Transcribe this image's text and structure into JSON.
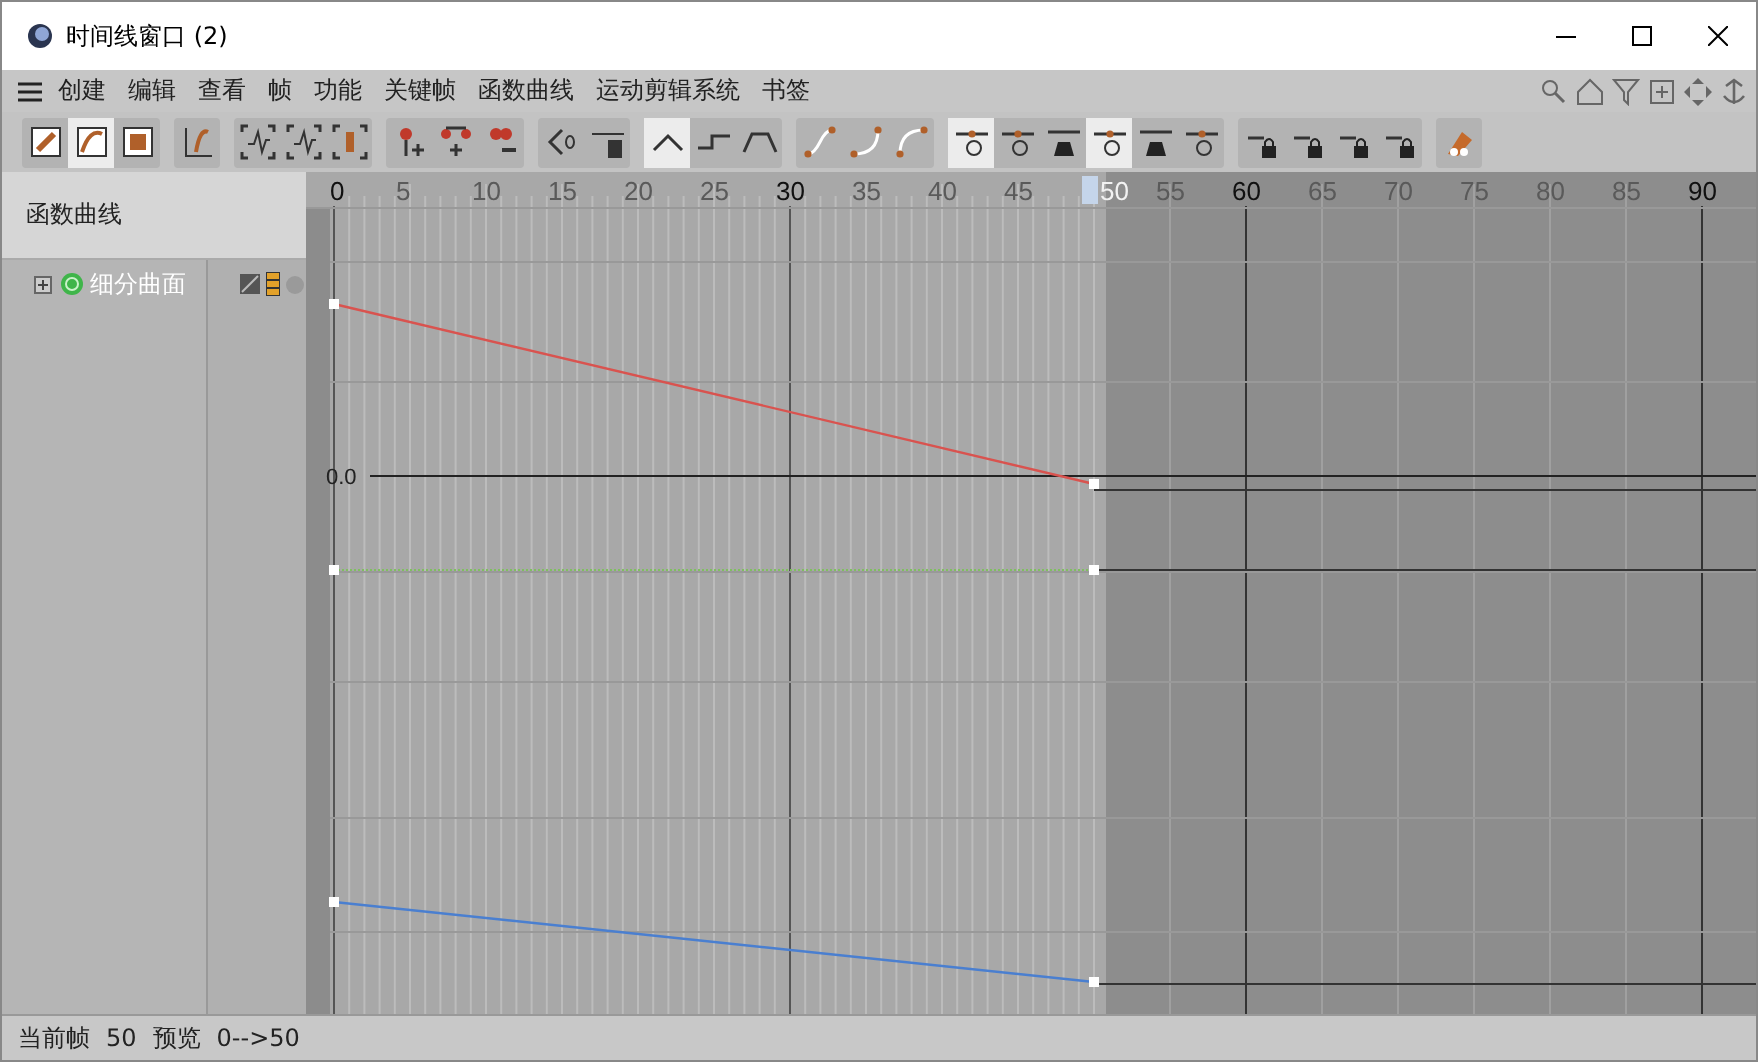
{
  "window": {
    "title": "时间线窗口 (2)"
  },
  "menu": [
    "创建",
    "编辑",
    "查看",
    "帧",
    "功能",
    "关键帧",
    "函数曲线",
    "运动剪辑系统",
    "书签"
  ],
  "toolbar": [
    [
      {
        "selected": false
      },
      {
        "selected": true
      },
      {
        "selected": false
      }
    ],
    [
      {
        "selected": false
      }
    ],
    [
      {
        "selected": false
      },
      {
        "selected": false
      },
      {
        "selected": false
      }
    ],
    [
      {
        "selected": false
      },
      {
        "selected": false
      },
      {
        "selected": false
      }
    ],
    [
      {
        "selected": false
      },
      {
        "selected": false
      }
    ],
    [
      {
        "selected": true
      },
      {
        "selected": false
      },
      {
        "selected": false
      }
    ],
    [
      {
        "selected": false
      },
      {
        "selected": false
      },
      {
        "selected": false
      }
    ],
    [
      {
        "selected": true
      },
      {
        "selected": false
      },
      {
        "selected": false
      },
      {
        "selected": true
      },
      {
        "selected": false
      },
      {
        "selected": false
      }
    ],
    [
      {
        "selected": false
      },
      {
        "selected": false
      },
      {
        "selected": false
      },
      {
        "selected": false
      }
    ],
    [
      {
        "selected": false
      }
    ]
  ],
  "panel": {
    "title": "函数曲线",
    "items": [
      {
        "label": "细分曲面",
        "expanded": false
      }
    ]
  },
  "ruler": [
    {
      "label": "0",
      "kind": "major"
    },
    {
      "label": "5",
      "kind": "minor"
    },
    {
      "label": "10",
      "kind": "minor"
    },
    {
      "label": "15",
      "kind": "minor"
    },
    {
      "label": "20",
      "kind": "minor"
    },
    {
      "label": "25",
      "kind": "minor"
    },
    {
      "label": "30",
      "kind": "major"
    },
    {
      "label": "35",
      "kind": "minor"
    },
    {
      "label": "40",
      "kind": "minor"
    },
    {
      "label": "45",
      "kind": "minor"
    },
    {
      "label": "50",
      "kind": "current"
    },
    {
      "label": "55",
      "kind": "minor"
    },
    {
      "label": "60",
      "kind": "major"
    },
    {
      "label": "65",
      "kind": "minor"
    },
    {
      "label": "70",
      "kind": "minor"
    },
    {
      "label": "75",
      "kind": "minor"
    },
    {
      "label": "80",
      "kind": "minor"
    },
    {
      "label": "85",
      "kind": "minor"
    },
    {
      "label": "90",
      "kind": "major"
    }
  ],
  "graph": {
    "zero_label": "0.0"
  },
  "status_bar": {
    "current_frame_label": "当前帧",
    "current_frame": "50",
    "preview_label": "预览",
    "preview": "0-->50"
  }
}
